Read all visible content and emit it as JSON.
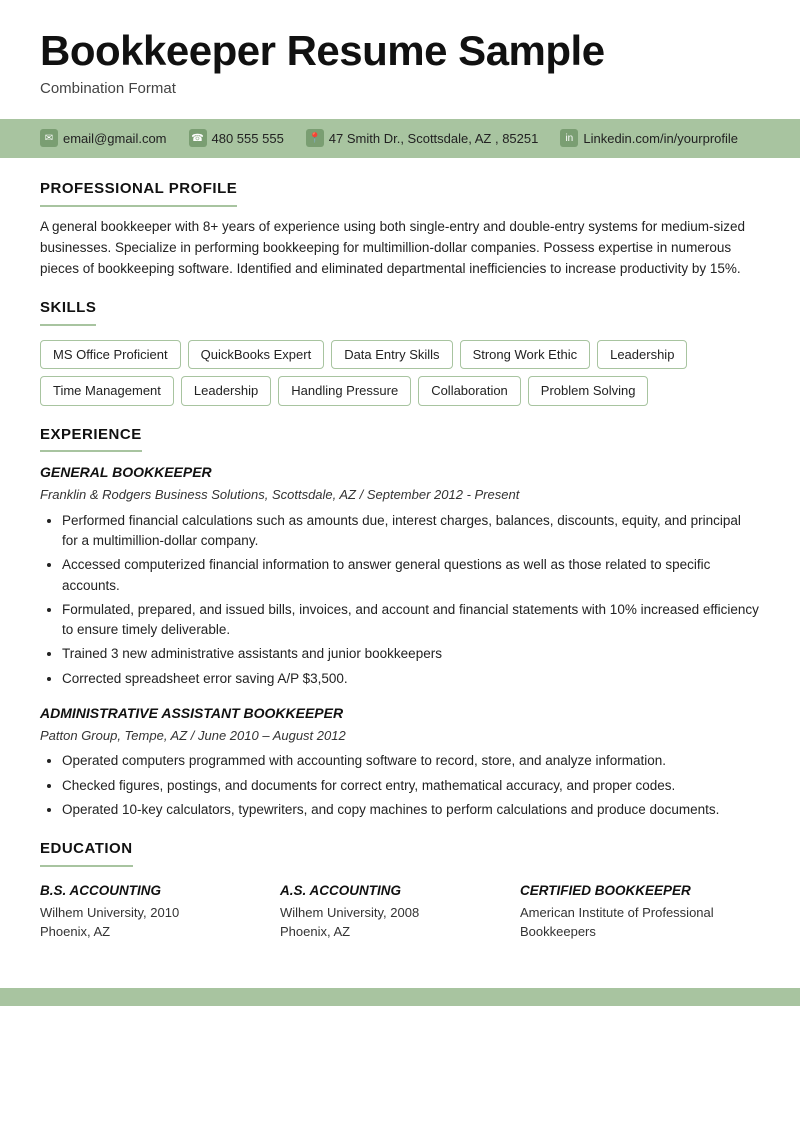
{
  "header": {
    "title": "Bookkeeper Resume Sample",
    "subtitle": "Combination Format"
  },
  "contact": {
    "email": "email@gmail.com",
    "phone": "480 555 555",
    "address": "47 Smith Dr., Scottsdale, AZ , 85251",
    "linkedin": "Linkedin.com/in/yourprofile"
  },
  "sections": {
    "profile": {
      "title": "PROFESSIONAL PROFILE",
      "text": "A general bookkeeper with 8+ years of experience using both single-entry and double-entry systems for medium-sized businesses. Specialize in performing bookkeeping for multimillion-dollar companies. Possess expertise in numerous pieces of bookkeeping software. Identified and eliminated departmental inefficiencies to increase productivity by 15%."
    },
    "skills": {
      "title": "SKILLS",
      "items": [
        "MS Office Proficient",
        "QuickBooks Expert",
        "Data Entry Skills",
        "Strong Work Ethic",
        "Leadership",
        "Time Management",
        "Leadership",
        "Handling Pressure",
        "Collaboration",
        "Problem Solving"
      ]
    },
    "experience": {
      "title": "EXPERIENCE",
      "jobs": [
        {
          "title": "GENERAL BOOKKEEPER",
          "company": "Franklin & Rodgers Business Solutions, Scottsdale, AZ  /  September 2012 - Present",
          "bullets": [
            "Performed financial calculations such as amounts due, interest charges, balances, discounts, equity, and principal for a multimillion-dollar company.",
            "Accessed computerized financial information to answer general questions as well as those related to specific accounts.",
            "Formulated, prepared, and issued bills, invoices, and account and financial statements with 10% increased efficiency to ensure timely deliverable.",
            "Trained 3 new administrative assistants and junior bookkeepers",
            "Corrected spreadsheet error saving A/P $3,500."
          ]
        },
        {
          "title": "ADMINISTRATIVE ASSISTANT BOOKKEEPER",
          "company": "Patton Group, Tempe, AZ  /  June 2010 – August 2012",
          "bullets": [
            "Operated computers programmed with accounting software to record, store, and analyze information.",
            "Checked figures, postings, and documents for correct entry, mathematical accuracy, and proper codes.",
            "Operated 10-key calculators, typewriters, and copy machines to perform calculations and produce documents."
          ]
        }
      ]
    },
    "education": {
      "title": "EDUCATION",
      "degrees": [
        {
          "degree": "B.S. ACCOUNTING",
          "line1": "Wilhem University, 2010",
          "line2": "Phoenix, AZ"
        },
        {
          "degree": "A.S. ACCOUNTING",
          "line1": "Wilhem University, 2008",
          "line2": "Phoenix, AZ"
        },
        {
          "degree": "CERTIFIED BOOKKEEPER",
          "line1": "American Institute of Professional Bookkeepers",
          "line2": ""
        }
      ]
    }
  }
}
